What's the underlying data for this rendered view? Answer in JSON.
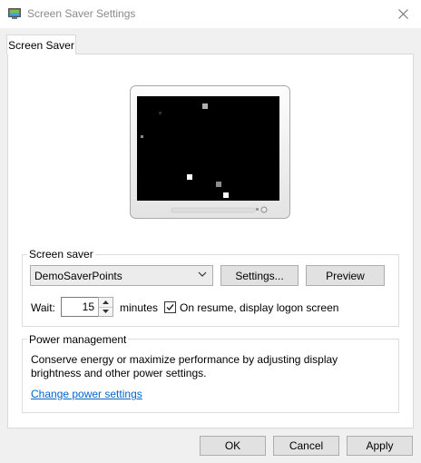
{
  "window": {
    "title": "Screen Saver Settings"
  },
  "tabs": [
    {
      "label": "Screen Saver"
    }
  ],
  "screen_saver": {
    "group_label": "Screen saver",
    "selected": "DemoSaverPoints",
    "settings_label": "Settings...",
    "preview_label": "Preview",
    "wait_label": "Wait:",
    "wait_value": "15",
    "minutes_label": "minutes",
    "resume_checked": true,
    "resume_label": "On resume, display logon screen"
  },
  "power": {
    "group_label": "Power management",
    "description_line1": "Conserve energy or maximize performance by adjusting display",
    "description_line2": "brightness and other power settings.",
    "link_label": "Change power settings"
  },
  "buttons": {
    "ok": "OK",
    "cancel": "Cancel",
    "apply": "Apply"
  },
  "colors": {
    "link": "#0066cc",
    "screen": "#000000",
    "monitor_bezel": "#f2f2f2"
  },
  "icons": {
    "app": "screen-saver-app-icon",
    "close": "close-icon",
    "dropdown": "chevron-down-icon",
    "spin_up": "arrow-up-icon",
    "spin_down": "arrow-down-icon",
    "check": "checkmark-icon"
  }
}
